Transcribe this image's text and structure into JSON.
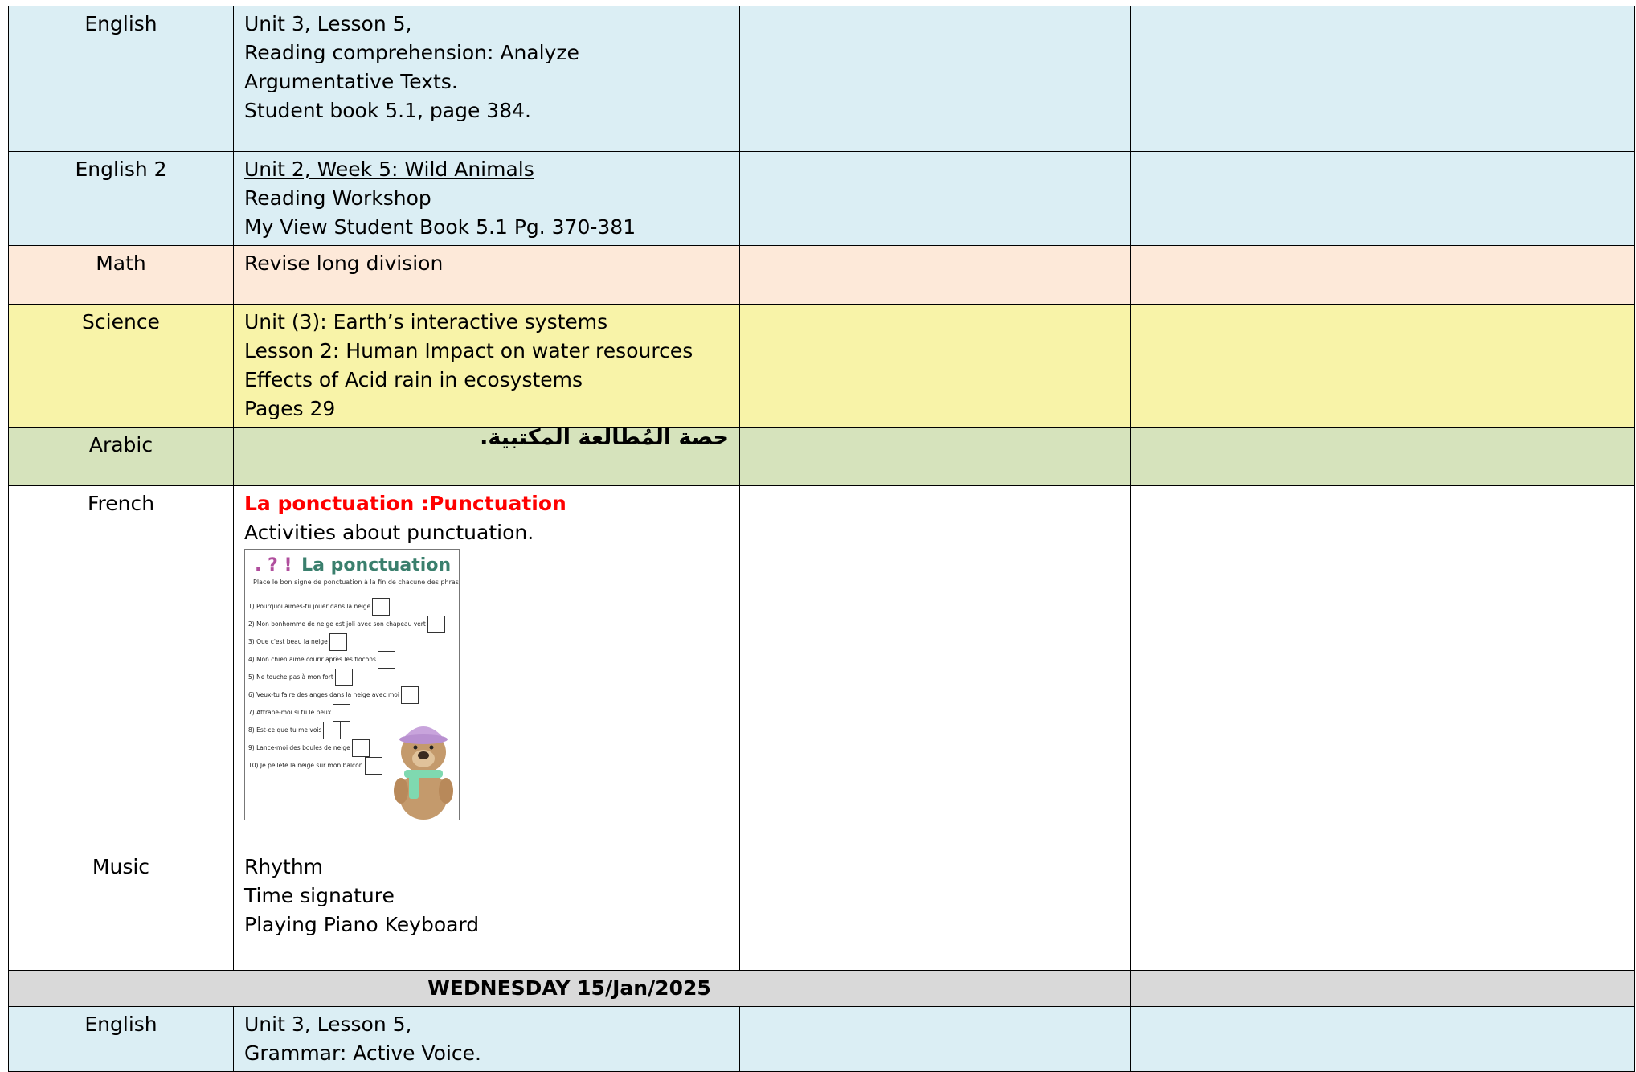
{
  "rows": {
    "english": {
      "subject": "English",
      "lines": [
        "Unit 3, Lesson 5,",
        "Reading comprehension: Analyze Argumentative Texts.",
        "Student book 5.1, page 384."
      ]
    },
    "english2": {
      "subject": "English 2",
      "lines": [
        "Unit 2, Week 5: Wild Animals",
        "Reading Workshop",
        "My View Student Book 5.1 Pg. 370-381"
      ]
    },
    "math": {
      "subject": "Math",
      "lines": [
        "Revise long division"
      ]
    },
    "science": {
      "subject": "Science",
      "lines": [
        "Unit (3): Earth’s interactive systems",
        "Lesson 2: Human Impact on water resources",
        "Effects of Acid rain in ecosystems",
        "Pages 29"
      ]
    },
    "arabic": {
      "subject": "Arabic",
      "text": "حصة المُطالعة المكتبية."
    },
    "french": {
      "subject": "French",
      "heading": "La ponctuation :Punctuation",
      "line": "Activities about punctuation.",
      "worksheet": {
        "marks": ". ? !",
        "title": "La ponctuation",
        "instruction": "Place le bon signe de ponctuation à la fin de chacune des phrases.",
        "items": [
          "1) Pourquoi aimes-tu jouer dans la neige",
          "2) Mon bonhomme de neige est joli avec son chapeau vert",
          "3) Que c'est beau la neige",
          "4) Mon chien aime courir après les flocons",
          "5) Ne touche pas à mon fort",
          "6) Veux-tu faire des anges dans la neige avec moi",
          "7) Attrape-moi si tu le peux",
          "8) Est-ce que tu me vois",
          "9) Lance-moi des boules de neige",
          "10) Je pellète la neige sur mon balcon"
        ]
      }
    },
    "music": {
      "subject": "Music",
      "lines": [
        "Rhythm",
        "Time signature",
        "Playing Piano Keyboard"
      ]
    },
    "day": {
      "label": "WEDNESDAY 15/Jan/2025"
    },
    "english_wed": {
      "subject": "English",
      "lines": [
        "Unit 3, Lesson 5,",
        "Grammar: Active Voice."
      ]
    }
  },
  "colors": {
    "english": "#dbeef4",
    "math": "#fde9d9",
    "science": "#f8f3a8",
    "arabic": "#d6e3bc",
    "day_header": "#d9d9d9",
    "french_heading": "#ff0000"
  }
}
